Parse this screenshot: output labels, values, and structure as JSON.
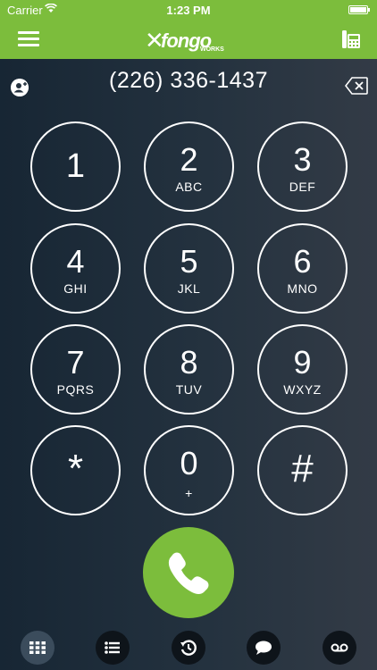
{
  "status_bar": {
    "carrier": "Carrier",
    "time": "1:23 PM"
  },
  "nav": {
    "logo_text": "fongo",
    "logo_sub": "WORKS",
    "menu_icon": "hamburger-menu-icon",
    "right_icon": "desk-phone-icon"
  },
  "dialer": {
    "number": "(226) 336-1437",
    "keys": [
      {
        "digit": "1",
        "letters": ""
      },
      {
        "digit": "2",
        "letters": "ABC"
      },
      {
        "digit": "3",
        "letters": "DEF"
      },
      {
        "digit": "4",
        "letters": "GHI"
      },
      {
        "digit": "5",
        "letters": "JKL"
      },
      {
        "digit": "6",
        "letters": "MNO"
      },
      {
        "digit": "7",
        "letters": "PQRS"
      },
      {
        "digit": "8",
        "letters": "TUV"
      },
      {
        "digit": "9",
        "letters": "WXYZ"
      },
      {
        "digit": "*",
        "letters": ""
      },
      {
        "digit": "0",
        "letters": "+"
      },
      {
        "digit": "#",
        "letters": ""
      }
    ]
  },
  "tabs": [
    {
      "icon": "keypad-icon",
      "active": true
    },
    {
      "icon": "contacts-list-icon",
      "active": false
    },
    {
      "icon": "history-icon",
      "active": false
    },
    {
      "icon": "messages-icon",
      "active": false
    },
    {
      "icon": "voicemail-icon",
      "active": false
    }
  ],
  "colors": {
    "brand_green": "#7cbd3c",
    "background_left": "#172634",
    "background_right": "#333b46"
  }
}
